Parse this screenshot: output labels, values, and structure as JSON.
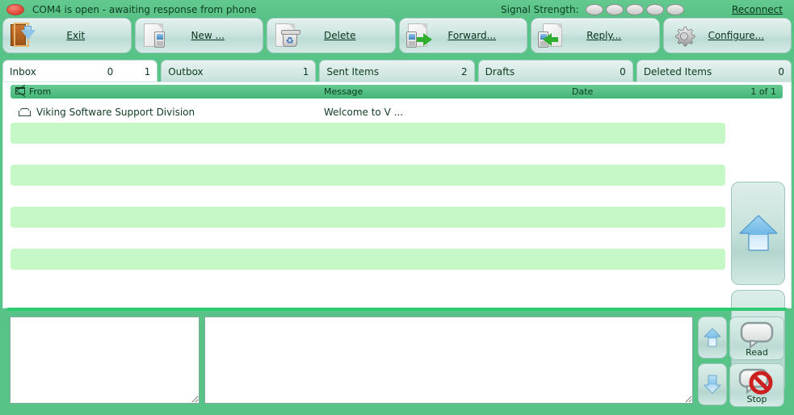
{
  "statusbar": {
    "led_icon": "status-led-red",
    "status_text": "COM4 is open - awaiting response from phone",
    "signal_label": "Signal Strength:",
    "signal_bars": 5,
    "signal_bars_on": 0,
    "reconnect_label": "Reconnect",
    "bar_color_off": "#c8c8c8",
    "bar_color_on": "#3bb84e"
  },
  "toolbar": {
    "buttons": [
      {
        "label": "Exit",
        "icon": "exit-door-icon"
      },
      {
        "label": "New ...",
        "icon": "new-message-icon"
      },
      {
        "label": "Delete",
        "icon": "delete-trash-icon"
      },
      {
        "label": "Forward...",
        "icon": "forward-phone-icon"
      },
      {
        "label": "Reply...",
        "icon": "reply-phone-icon"
      },
      {
        "label": "Configure...",
        "icon": "gear-icon"
      }
    ]
  },
  "tabs": [
    {
      "name": "Inbox",
      "count1": "0",
      "count2": "1",
      "active": true
    },
    {
      "name": "Outbox",
      "count1": "1",
      "count2": "",
      "active": false
    },
    {
      "name": "Sent Items",
      "count1": "2",
      "count2": "",
      "active": false
    },
    {
      "name": "Drafts",
      "count1": "0",
      "count2": "",
      "active": false
    },
    {
      "name": "Deleted Items",
      "count1": "0",
      "count2": "",
      "active": false
    }
  ],
  "list": {
    "header": {
      "envelope_icon": "envelope-icon",
      "from": "From",
      "message": "Message",
      "date": "Date",
      "counter": "1 of 1"
    },
    "rows": [
      {
        "icon": "open-envelope-icon",
        "from": "Viking Software Support Division",
        "message": "Welcome to V ...",
        "date": "",
        "alt": false
      },
      {
        "icon": "",
        "from": "",
        "message": "",
        "date": "",
        "alt": true
      },
      {
        "icon": "",
        "from": "",
        "message": "",
        "date": "",
        "alt": false
      },
      {
        "icon": "",
        "from": "",
        "message": "",
        "date": "",
        "alt": true
      },
      {
        "icon": "",
        "from": "",
        "message": "",
        "date": "",
        "alt": false
      },
      {
        "icon": "",
        "from": "",
        "message": "",
        "date": "",
        "alt": true
      },
      {
        "icon": "",
        "from": "",
        "message": "",
        "date": "",
        "alt": false
      },
      {
        "icon": "",
        "from": "",
        "message": "",
        "date": "",
        "alt": true
      },
      {
        "icon": "",
        "from": "",
        "message": "",
        "date": "",
        "alt": false
      }
    ],
    "scroll_up_icon": "arrow-up-icon",
    "scroll_down_icon": "arrow-down-icon"
  },
  "bottom": {
    "left_textbox_value": "",
    "right_textbox_value": "",
    "scroll_up_icon": "arrow-up-icon",
    "scroll_down_icon": "arrow-down-icon",
    "read_label": "Read",
    "read_icon": "speech-bubble-icon",
    "stop_label": "Stop",
    "stop_icon": "speech-bubble-blocked-icon"
  },
  "theme": {
    "background_green": "#57c387",
    "row_alt_green": "#c6f7c6",
    "header_green": "#45b678",
    "panel_white": "#ffffff",
    "button_face": "#c6e0da"
  }
}
